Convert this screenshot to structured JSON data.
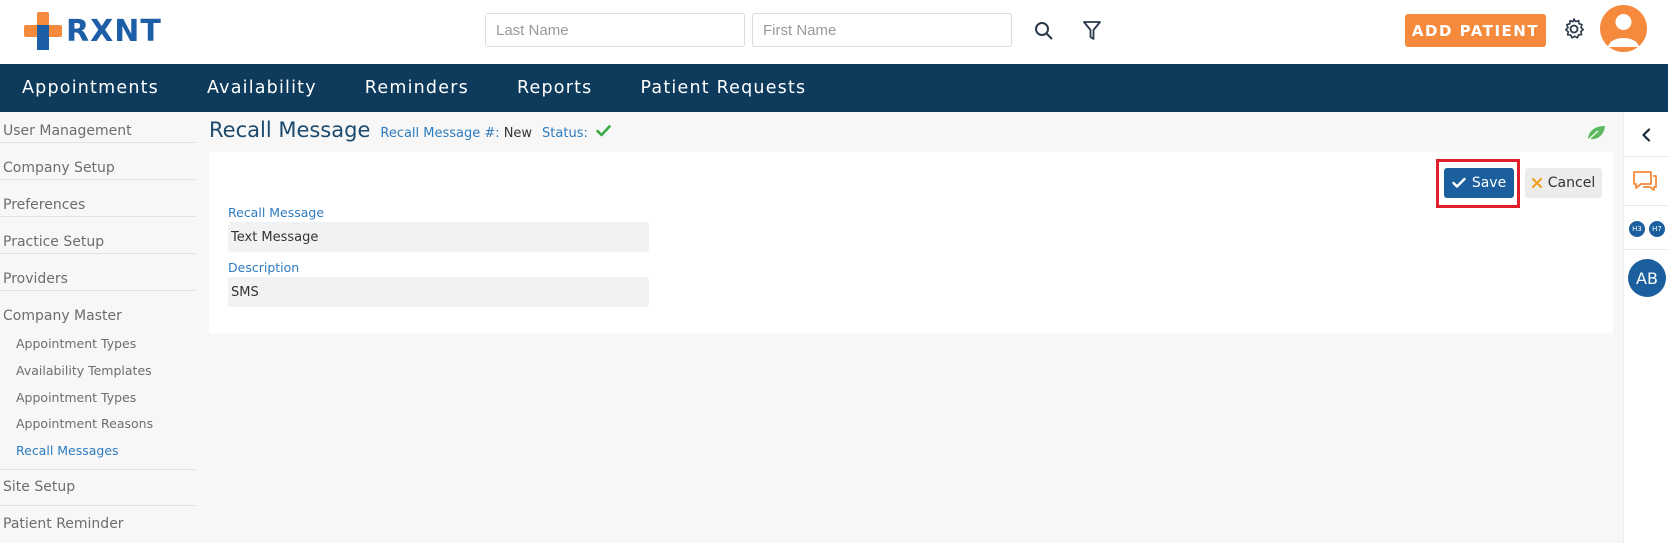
{
  "header": {
    "brand": "RXNT",
    "search": {
      "last_name_placeholder": "Last Name",
      "first_name_placeholder": "First Name",
      "last_name_value": "",
      "first_name_value": ""
    },
    "add_patient_label": "ADD PATIENT"
  },
  "nav": {
    "items": [
      "Appointments",
      "Availability",
      "Reminders",
      "Reports",
      "Patient Requests"
    ]
  },
  "sidebar": {
    "user_management": "User Management",
    "company_setup": "Company Setup",
    "preferences": "Preferences",
    "practice_setup": "Practice Setup",
    "providers": "Providers",
    "company_master": "Company Master",
    "sub_items": [
      "Appointment Types",
      "Availability Templates",
      "Appointment Types",
      "Appointment Reasons",
      "Recall Messages"
    ],
    "active_sub": "Recall Messages",
    "site_setup": "Site Setup",
    "patient_reminder": "Patient Reminder"
  },
  "page": {
    "title": "Recall Message",
    "number_label": "Recall Message #:",
    "number_value": "New",
    "status_label": "Status:",
    "status_icon": "checkmark-icon"
  },
  "actions": {
    "save_label": "Save",
    "cancel_label": "Cancel"
  },
  "form": {
    "recall_message_label": "Recall Message",
    "recall_message_value": "Text Message",
    "description_label": "Description",
    "description_value": "SMS"
  },
  "rail": {
    "badges": [
      "H3",
      "H7"
    ],
    "avatar_initials": "AB"
  },
  "colors": {
    "brand_blue": "#1d5fa6",
    "nav_bg": "#0e3a5c",
    "accent_orange": "#f58a3d",
    "link_blue": "#2d7bbf",
    "success_green": "#3aa845",
    "highlight_red": "#e01f2b"
  }
}
